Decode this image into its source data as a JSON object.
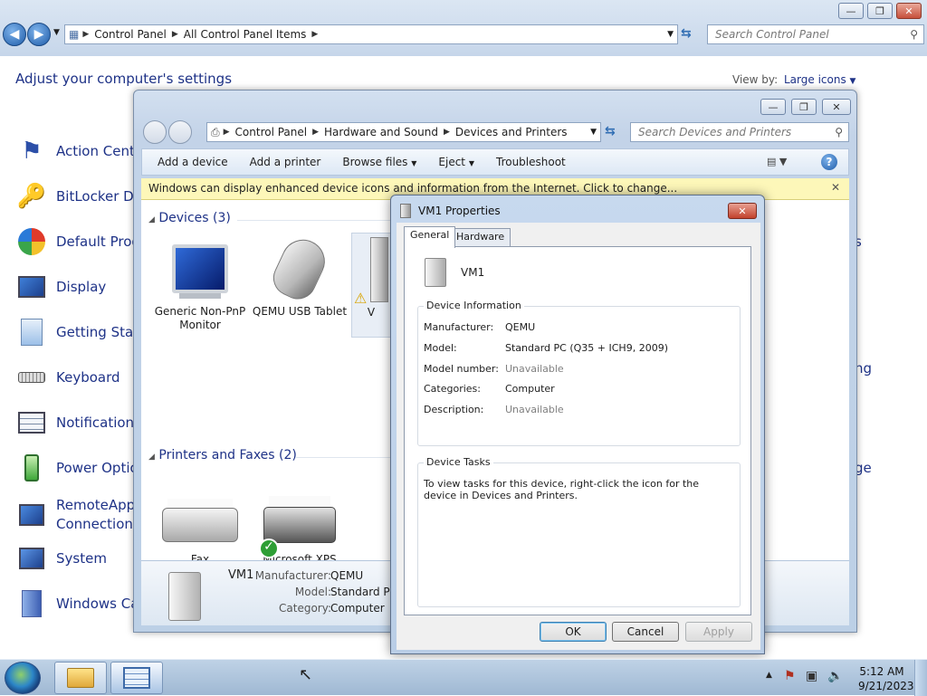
{
  "background_window": {
    "breadcrumb": [
      "Control Panel",
      "All Control Panel Items"
    ],
    "search_placeholder": "Search Control Panel",
    "heading": "Adjust your computer's settings",
    "view_by_label": "View by:",
    "view_by_value": "Large icons",
    "items": [
      {
        "label": "Action Cente",
        "icon": "flag-icon"
      },
      {
        "label": "BitLocker Dr",
        "icon": "bitlocker-icon"
      },
      {
        "label": "Default Prog",
        "icon": "default-programs-icon"
      },
      {
        "label": "Display",
        "icon": "display-icon"
      },
      {
        "label": "Getting Start",
        "icon": "getting-started-icon"
      },
      {
        "label": "Keyboard",
        "icon": "keyboard-icon"
      },
      {
        "label": "Notification",
        "icon": "notification-icon"
      },
      {
        "label": "Power Optio",
        "icon": "power-icon"
      },
      {
        "label": "RemoteApp",
        "label2": "Connections",
        "icon": "remoteapp-icon"
      },
      {
        "label": "System",
        "icon": "system-icon"
      },
      {
        "label": "Windows Ca",
        "icon": "windows-cardspace-icon"
      }
    ],
    "right_fragments": [
      "s",
      "ng",
      "ge"
    ]
  },
  "devices_window": {
    "breadcrumb": [
      "Control Panel",
      "Hardware and Sound",
      "Devices and Printers"
    ],
    "search_placeholder": "Search Devices and Printers",
    "toolbar": {
      "add_device": "Add a device",
      "add_printer": "Add a printer",
      "browse_files": "Browse files",
      "eject": "Eject",
      "troubleshoot": "Troubleshoot"
    },
    "info_bar": "Windows can display enhanced device icons and information from the Internet. Click to change...",
    "devices_group": "Devices (3)",
    "printers_group": "Printers and Faxes (2)",
    "devices": [
      {
        "label": "Generic Non-PnP Monitor",
        "icon": "monitor-icon"
      },
      {
        "label": "QEMU USB Tablet",
        "icon": "mouse-icon"
      },
      {
        "label": "V",
        "icon": "computer-icon"
      }
    ],
    "printers": [
      {
        "label": "Fax",
        "icon": "fax-icon"
      },
      {
        "label": "Microsoft XPS Document Writer",
        "icon": "printer-icon"
      }
    ],
    "details": {
      "name": "VM1",
      "manufacturer_label": "Manufacturer:",
      "manufacturer": "QEMU",
      "model_label": "Model:",
      "model": "Standard PC",
      "category_label": "Category:",
      "category": "Computer"
    }
  },
  "properties_dialog": {
    "title": "VM1 Properties",
    "tabs": [
      "General",
      "Hardware"
    ],
    "device_name": "VM1",
    "device_information_legend": "Device Information",
    "fields": [
      {
        "label": "Manufacturer:",
        "value": "QEMU",
        "gray": false
      },
      {
        "label": "Model:",
        "value": "Standard PC (Q35 + ICH9, 2009)",
        "gray": false
      },
      {
        "label": "Model number:",
        "value": "Unavailable",
        "gray": true
      },
      {
        "label": "Categories:",
        "value": "Computer",
        "gray": false
      },
      {
        "label": "Description:",
        "value": "Unavailable",
        "gray": true
      }
    ],
    "device_tasks_legend": "Device Tasks",
    "device_tasks_text": "To view tasks for this device, right-click the icon for the device in Devices and Printers.",
    "ok": "OK",
    "cancel": "Cancel",
    "apply": "Apply"
  },
  "taskbar": {
    "time": "5:12 AM",
    "date": "9/21/2023"
  }
}
